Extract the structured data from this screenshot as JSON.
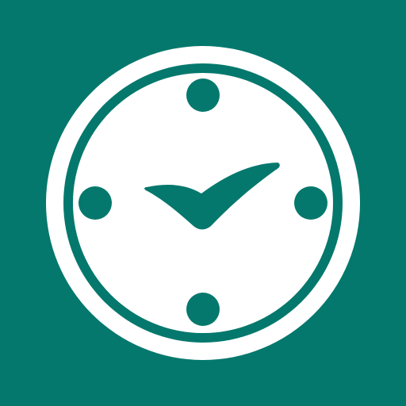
{
  "app_icon": {
    "icon_name": "clock-icon",
    "colors": {
      "background": "#04786c",
      "face": "#ffffff",
      "ring_gap": "#04786c",
      "marks_and_hands": "#04786c"
    }
  }
}
